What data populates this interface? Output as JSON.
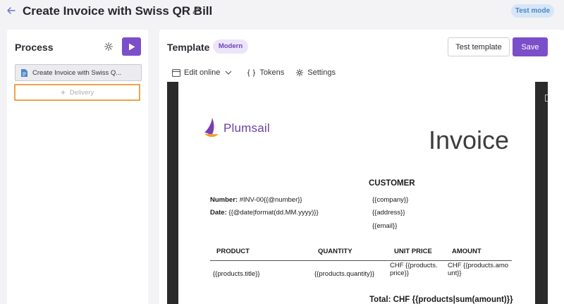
{
  "header": {
    "back_icon": "arrow-left-icon",
    "title": "Create Invoice with Swiss QR Bill",
    "edit_icon": "pencil-icon",
    "test_mode_label": "Test mode"
  },
  "process": {
    "title": "Process",
    "settings_icon": "gear-icon",
    "run_icon": "play-icon",
    "steps": [
      {
        "icon": "document-icon",
        "label": "Create Invoice with Swiss Q..."
      }
    ],
    "add_step_label": "Delivery"
  },
  "template": {
    "title": "Template",
    "badge": "Modern",
    "test_button_label": "Test template",
    "save_button_label": "Save",
    "toolbar": {
      "edit_online_label": "Edit online",
      "tokens_label": "Tokens",
      "settings_label": "Settings"
    }
  },
  "document": {
    "logo_text": "Plumsail",
    "heading": "Invoice",
    "customer_heading": "CUSTOMER",
    "number_label": "Number:",
    "number_value": "#INV-00{{@number}}",
    "date_label": "Date:",
    "date_value": "{{@date|format(dd.MM.yyyy)}}",
    "customer_fields": [
      "{{company}}",
      "{{address}}",
      "{{email}}"
    ],
    "table": {
      "headers": [
        "PRODUCT",
        "QUANTITY",
        "UNIT PRICE",
        "AMOUNT"
      ],
      "row": [
        "{{products.title}}",
        "{{products.quantity}}",
        "CHF {{products.price}}",
        "CHF {{products.amount}}"
      ]
    },
    "total_line": "Total: CHF {{products|sum(amount)}}"
  },
  "colors": {
    "accent": "#7b4fc9",
    "badge_bg": "#ece4f8",
    "test_mode_bg": "#d5e6f6",
    "test_mode_text": "#4d86c4",
    "delivery_outline": "#eda447"
  }
}
